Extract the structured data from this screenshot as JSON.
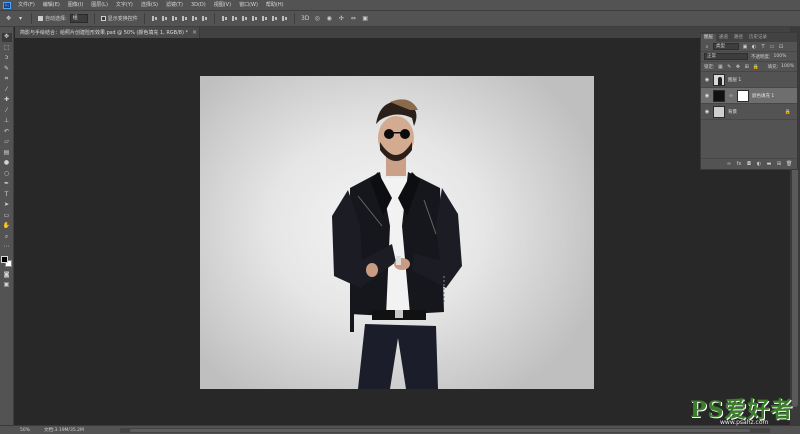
{
  "menubar": {
    "logo": "Ps",
    "items": [
      "文件(F)",
      "编辑(E)",
      "图像(I)",
      "图层(L)",
      "文字(Y)",
      "选择(S)",
      "滤镜(T)",
      "3D(D)",
      "视图(V)",
      "窗口(W)",
      "帮助(H)"
    ]
  },
  "options": {
    "auto_select_label": "自动选择:",
    "auto_select_value": "组",
    "show_transform_label": "显示变换控件"
  },
  "document": {
    "tab_title": "简影与手绘结合：给照片创建险形效果.psd @ 50% (颜色填充 1, RGB/8) *",
    "tab_close": "×"
  },
  "layers_panel": {
    "tabs": [
      "图层",
      "通道",
      "路径",
      "历史记录"
    ],
    "kind_filter": "类型",
    "blend_mode": "正常",
    "opacity_label": "不透明度:",
    "opacity_value": "100%",
    "lock_label": "锁定:",
    "fill_label": "填充:",
    "fill_value": "100%",
    "layers": [
      {
        "name": "图层 1",
        "visible": true,
        "selected": false
      },
      {
        "name": "颜色填充 1",
        "visible": true,
        "selected": true
      },
      {
        "name": "背景",
        "visible": true,
        "selected": false,
        "locked": true
      }
    ],
    "footer_icons": [
      "link-icon",
      "fx-icon",
      "mask-icon",
      "adjustment-icon",
      "group-icon",
      "new-layer-icon",
      "trash-icon"
    ]
  },
  "statusbar": {
    "zoom": "50%",
    "doc_info": "文档:3.19M/35.2M"
  },
  "watermark": {
    "main": "PS爱好者",
    "url": "www.psahz.com"
  },
  "colors": {
    "ui_panel": "#535353",
    "ui_dark": "#282828",
    "watermark_green": "#3b7f2a"
  }
}
